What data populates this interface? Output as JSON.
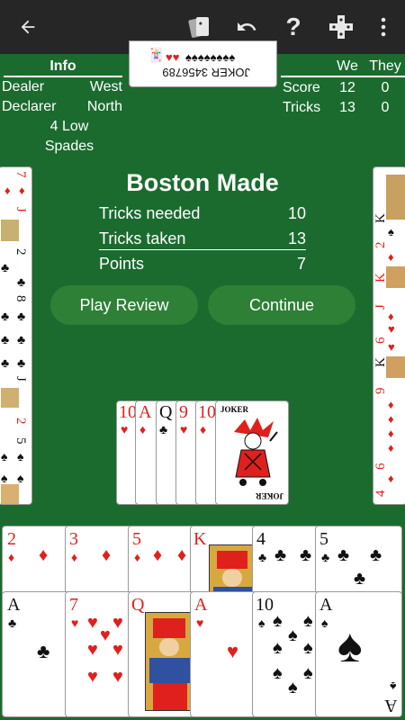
{
  "toolbar": {
    "back_icon": "arrow-left-icon",
    "cards_icon": "cards-icon",
    "undo_icon": "undo-icon",
    "help_label": "?",
    "dpad_icon": "dpad-icon",
    "more_icon": "more-vert-icon"
  },
  "info": {
    "header": "Info",
    "dealer_label": "Dealer",
    "dealer_value": "West",
    "declarer_label": "Declarer",
    "declarer_value": "North",
    "bid_line1": "4 Low",
    "bid_line2": "Spades"
  },
  "score": {
    "we_label": "We",
    "they_label": "They",
    "score_label": "Score",
    "score_we": "12",
    "score_they": "0",
    "tricks_label": "Tricks",
    "tricks_we": "13",
    "tricks_they": "0"
  },
  "result": {
    "title": "Boston Made",
    "needed_label": "Tricks needed",
    "needed_value": "10",
    "taken_label": "Tricks taken",
    "taken_value": "13",
    "points_label": "Points",
    "points_value": "7"
  },
  "buttons": {
    "review": "Play Review",
    "continue": "Continue"
  },
  "kitty": {
    "ranks": [
      "10",
      "A",
      "Q",
      "9",
      "10"
    ],
    "joker_label": "JOKER"
  },
  "hand_top": {
    "ranks": [
      "2",
      "3",
      "5",
      "K",
      "4",
      "5"
    ]
  },
  "hand_bottom": {
    "ranks": [
      "A",
      "7",
      "Q",
      "A",
      "10",
      "A"
    ]
  },
  "colors": {
    "felt": "#1b6b2f",
    "toolbar": "#262626",
    "button": "#2e8036",
    "red_suit": "#e0201c"
  }
}
